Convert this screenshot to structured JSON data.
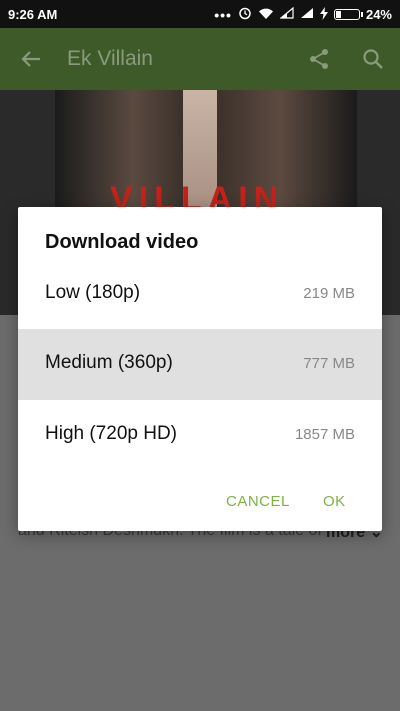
{
  "status_bar": {
    "time": "9:26 AM",
    "battery": "24%",
    "battery_level": 0.24
  },
  "app_bar": {
    "title": "Ek Villain"
  },
  "poster": {
    "overlay_text": "VILLAIN"
  },
  "background": {
    "description_fragment": "and Riteish Deshmukh. The film is a tale of",
    "more_label": "more"
  },
  "dialog": {
    "title": "Download video",
    "options": [
      {
        "label": "Low (180p)",
        "size": "219 MB",
        "selected": false
      },
      {
        "label": "Medium (360p)",
        "size": "777 MB",
        "selected": true
      },
      {
        "label": "High (720p HD)",
        "size": "1857 MB",
        "selected": false
      }
    ],
    "cancel_label": "CANCEL",
    "ok_label": "OK"
  },
  "colors": {
    "appbar": "#3e5a28",
    "accent": "#7cb342",
    "selected_row": "#e0e0e0"
  },
  "icons": [
    "back-arrow-icon",
    "share-icon",
    "search-icon",
    "wifi-icon",
    "signal-icon",
    "alarm-icon",
    "battery-icon",
    "chevron-down-icon"
  ]
}
